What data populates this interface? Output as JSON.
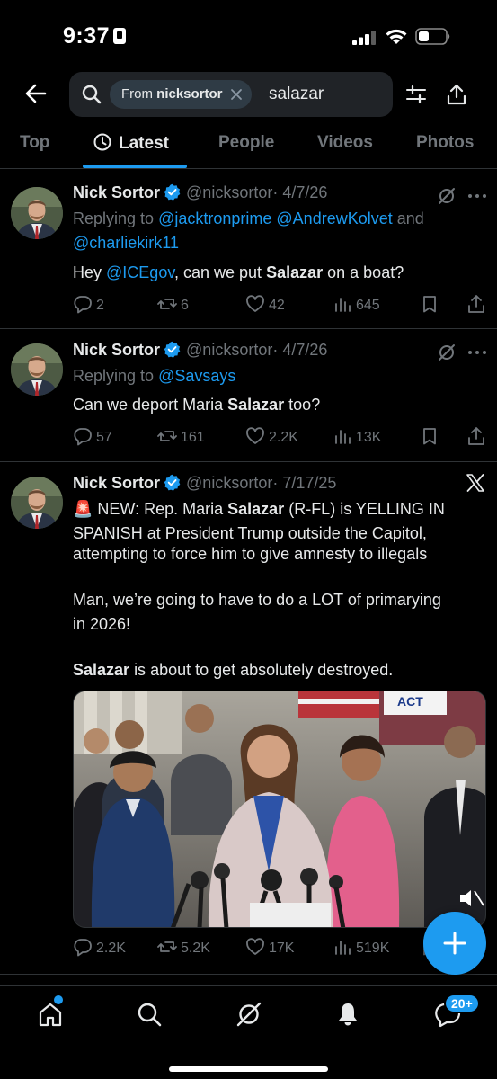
{
  "status_bar": {
    "time": "9:37"
  },
  "search": {
    "chip_prefix": "From",
    "chip_user": "nicksortor",
    "query": "salazar"
  },
  "tabs": [
    "Top",
    "Latest",
    "People",
    "Videos",
    "Photos"
  ],
  "active_tab": "Latest",
  "tweets": [
    {
      "name": "Nick Sortor",
      "handle": "@nicksortor",
      "date": "· 4/7/26",
      "replying_prefix": "Replying to",
      "replying_to_1": "@jacktronprime",
      "replying_to_2": "@AndrewKolvet",
      "replying_and": "and",
      "replying_to_3": "@charliekirk11",
      "text_1": "Hey",
      "text_mention": "@ICEgov",
      "text_2": ", can we put",
      "text_bold": "Salazar",
      "text_3": "on a boat?",
      "replies": "2",
      "reposts": "6",
      "likes": "42",
      "views": "645"
    },
    {
      "name": "Nick Sortor",
      "handle": "@nicksortor",
      "date": "· 4/7/26",
      "replying_prefix": "Replying to",
      "replying_to_1": "@Savsays",
      "text_1": "Can we deport Maria",
      "text_bold": "Salazar",
      "text_2": "too?",
      "replies": "57",
      "reposts": "161",
      "likes": "2.2K",
      "views": "13K"
    },
    {
      "name": "Nick Sortor",
      "handle": "@nicksortor",
      "date": "· 7/17/25",
      "line1_a": "🚨 NEW: Rep. Maria",
      "line1_bold": "Salazar",
      "line1_b": "(R-FL) is YELLING IN",
      "line2": "SPANISH at President Trump outside the Capitol,",
      "line3": "attempting to force him to give amnesty to illegals",
      "line4": "Man, we’re going to have to do a LOT of primarying",
      "line5": "in 2026!",
      "line6_bold": "Salazar",
      "line6_rest": "is about to get absolutely destroyed.",
      "media_sign": "ACT",
      "replies": "2.2K",
      "reposts": "5.2K",
      "likes": "17K",
      "views": "519K"
    }
  ],
  "notifications_badge": "20+",
  "colors": {
    "accent": "#1d9bf0",
    "background": "#000000",
    "muted": "#71767b",
    "text": "#e7e9ea",
    "divider": "#2f3336"
  }
}
